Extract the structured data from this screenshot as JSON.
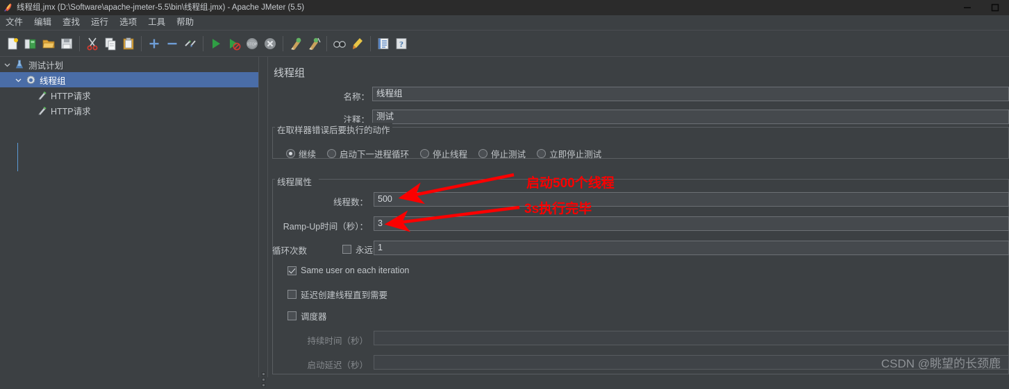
{
  "window": {
    "title": "线程组.jmx (D:\\Software\\apache-jmeter-5.5\\bin\\线程组.jmx) - Apache JMeter (5.5)",
    "app_icon": "jmeter-feather-icon",
    "controls": {
      "minimize": "minimize-icon",
      "maximize": "maximize-icon"
    }
  },
  "menubar": {
    "items": [
      {
        "label": "文件"
      },
      {
        "label": "编辑"
      },
      {
        "label": "查找"
      },
      {
        "label": "运行"
      },
      {
        "label": "选项"
      },
      {
        "label": "工具"
      },
      {
        "label": "帮助"
      }
    ]
  },
  "toolbar": {
    "buttons": [
      {
        "name": "new-icon"
      },
      {
        "name": "templates-icon"
      },
      {
        "name": "open-icon"
      },
      {
        "name": "save-icon"
      },
      {
        "name": "separator"
      },
      {
        "name": "cut-icon"
      },
      {
        "name": "copy-icon"
      },
      {
        "name": "paste-icon"
      },
      {
        "name": "separator"
      },
      {
        "name": "expand-all-icon"
      },
      {
        "name": "collapse-all-icon"
      },
      {
        "name": "toggle-icon"
      },
      {
        "name": "separator"
      },
      {
        "name": "start-icon"
      },
      {
        "name": "start-no-pauses-icon"
      },
      {
        "name": "stop-icon"
      },
      {
        "name": "shutdown-icon"
      },
      {
        "name": "separator"
      },
      {
        "name": "clear-icon"
      },
      {
        "name": "clear-all-icon"
      },
      {
        "name": "separator"
      },
      {
        "name": "search-icon"
      },
      {
        "name": "reset-search-icon"
      },
      {
        "name": "separator"
      },
      {
        "name": "function-helper-icon"
      },
      {
        "name": "help-icon"
      }
    ]
  },
  "tree": {
    "nodes": [
      {
        "label": "测试计划",
        "icon": "test-plan-icon",
        "depth": 0,
        "expanded": true,
        "selected": false
      },
      {
        "label": "线程组",
        "icon": "thread-group-icon",
        "depth": 1,
        "expanded": true,
        "selected": true
      },
      {
        "label": "HTTP请求",
        "icon": "http-request-icon",
        "depth": 2,
        "expanded": false,
        "selected": false
      },
      {
        "label": "HTTP请求",
        "icon": "http-request-icon",
        "depth": 2,
        "expanded": false,
        "selected": false
      }
    ]
  },
  "panel": {
    "title": "线程组",
    "name_label": "名称：",
    "name_value": "线程组",
    "comment_label": "注释：",
    "comment_value": "测试",
    "error_action": {
      "group_title": "在取样器错误后要执行的动作",
      "options": [
        {
          "label": "继续",
          "selected": true
        },
        {
          "label": "启动下一进程循环",
          "selected": false
        },
        {
          "label": "停止线程",
          "selected": false
        },
        {
          "label": "停止测试",
          "selected": false
        },
        {
          "label": "立即停止测试",
          "selected": false
        }
      ]
    },
    "thread_properties": {
      "group_title": "线程属性",
      "threads_label": "线程数：",
      "threads_value": "500",
      "rampup_label": "Ramp-Up时间（秒）：",
      "rampup_value": "3",
      "loops_label": "循环次数",
      "loops_forever_label": "永远",
      "loops_forever_checked": false,
      "loops_value": "1",
      "same_user_label": "Same user on each iteration",
      "same_user_checked": true,
      "delayed_start_label": "延迟创建线程直到需要",
      "delayed_start_checked": false,
      "scheduler_label": "调度器",
      "scheduler_checked": false,
      "duration_label": "持续时间（秒）",
      "duration_value": "",
      "duration_disabled": true,
      "startup_delay_label": "启动延迟（秒）",
      "startup_delay_value": "",
      "startup_delay_disabled": true
    }
  },
  "annotations": {
    "accent_color": "#fb0000",
    "items": [
      {
        "text": "启动500个线程"
      },
      {
        "text": "3s执行完毕"
      }
    ]
  },
  "watermark": {
    "text": "CSDN @眺望的长颈鹿"
  }
}
